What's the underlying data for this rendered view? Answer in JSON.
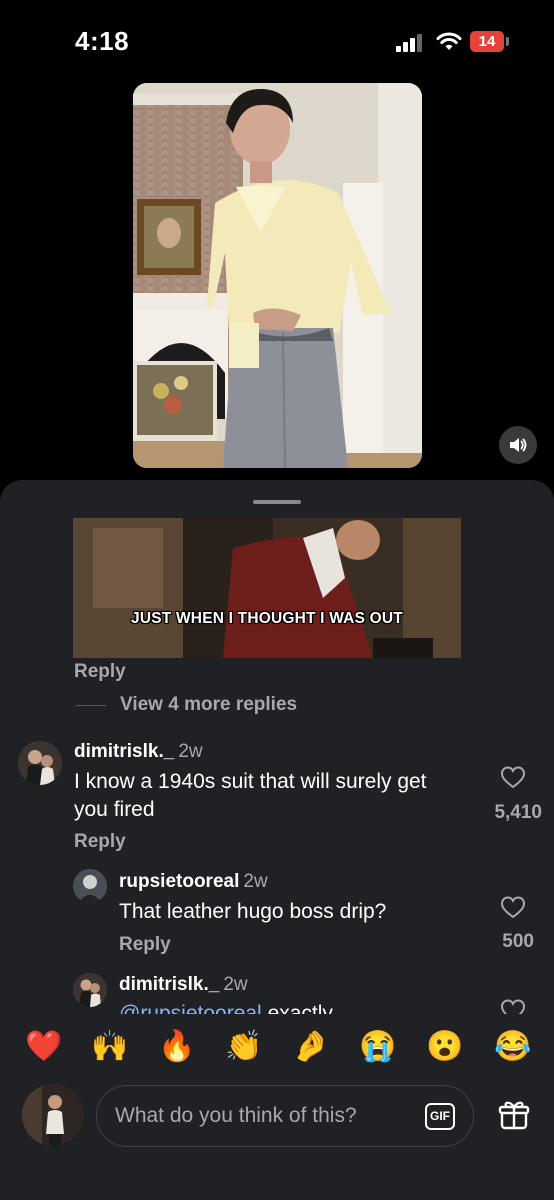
{
  "status_bar": {
    "time": "4:18",
    "battery": "14"
  },
  "gif_reply": {
    "caption": "JUST WHEN I THOUGHT I WAS OUT",
    "reply_label": "Reply",
    "view_more_label": "View 4 more replies"
  },
  "comments": [
    {
      "username": "dimitrislk._",
      "age": "2w",
      "text": "I know a 1940s suit that will surely get you fired",
      "reply_label": "Reply",
      "likes": "5,410"
    },
    {
      "username": "rupsietooreal",
      "age": "2w",
      "text": "That leather hugo boss drip?",
      "reply_label": "Reply",
      "likes": "500"
    },
    {
      "username": "dimitrislk._",
      "age": "2w",
      "text_mention": "@rupsietooreal",
      "text_rest": " exactly"
    }
  ],
  "reactions": [
    "❤️",
    "🙌",
    "🔥",
    "👏",
    "🤌",
    "😭",
    "😮",
    "😂"
  ],
  "composer": {
    "placeholder": "What do you think of this?",
    "gif_label": "GIF"
  },
  "colors": {
    "sheet_bg": "#1f2124",
    "battery": "#e5423a",
    "muted_text": "#a8a8ad"
  }
}
